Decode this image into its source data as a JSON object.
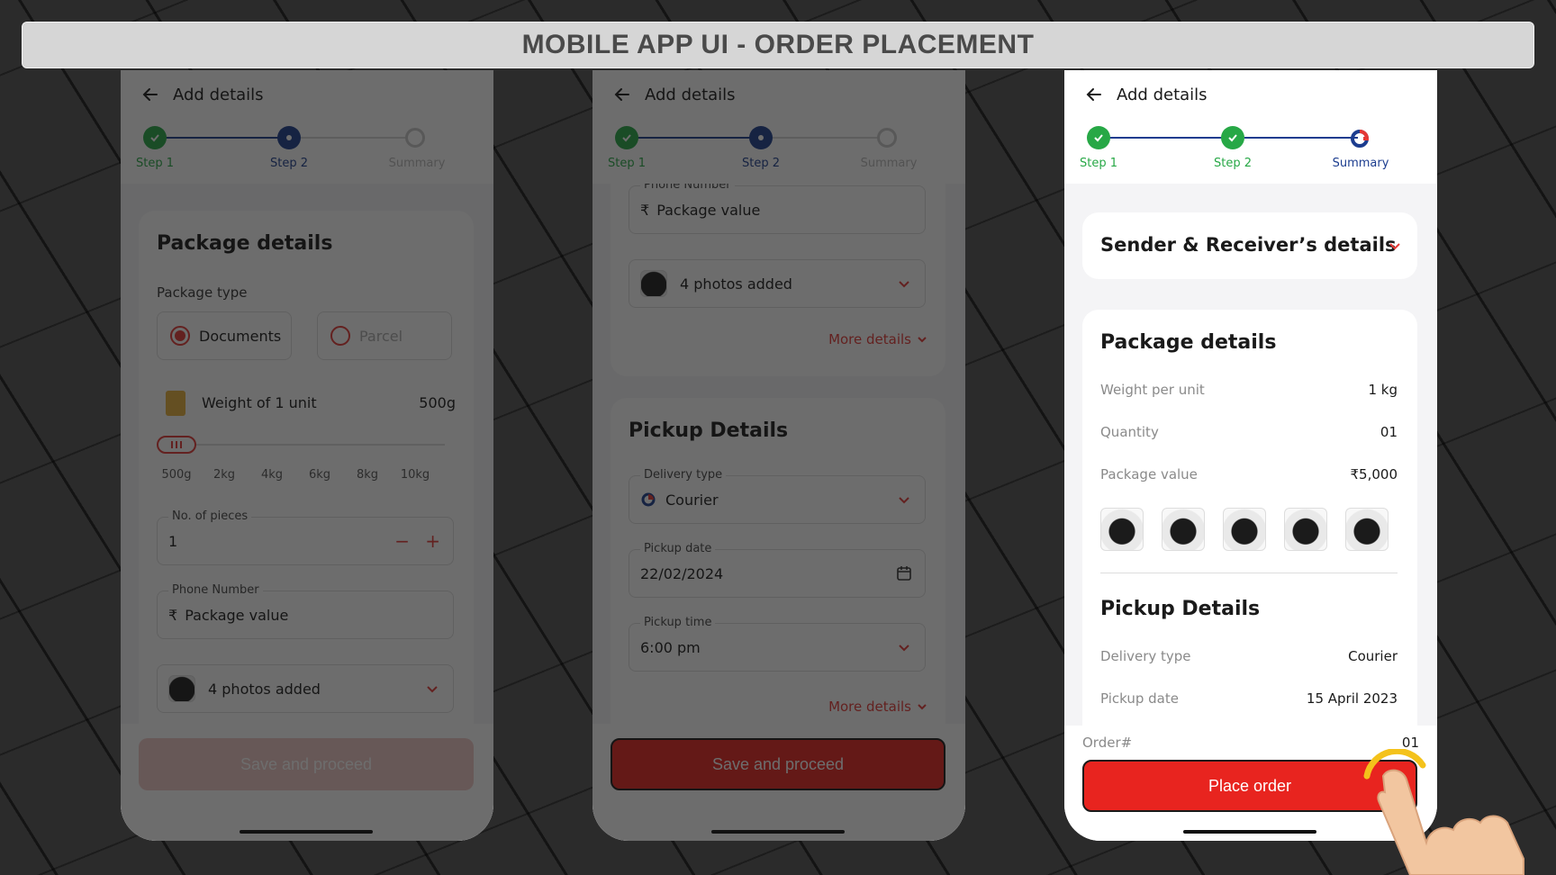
{
  "banner": {
    "title": "MOBILE APP UI - ORDER PLACEMENT"
  },
  "header": {
    "title": "Add details"
  },
  "steps": [
    {
      "label": "Step 1"
    },
    {
      "label": "Step 2"
    },
    {
      "label": "Summary"
    }
  ],
  "screen1": {
    "package_title": "Package details",
    "package_type_label": "Package type",
    "options": [
      "Documents",
      "Parcel"
    ],
    "weight_label": "Weight of 1 unit",
    "weight_value": "500g",
    "slider_ticks": [
      "500g",
      "2kg",
      "4kg",
      "6kg",
      "8kg",
      "10kg"
    ],
    "slider_level": 0,
    "pieces_label": "No. of pieces",
    "pieces_value": "1",
    "phone_label": "Phone Number",
    "currency_symbol": "₹",
    "package_value_placeholder": "Package value",
    "photos_text": "4 photos added",
    "button": "Save and proceed"
  },
  "screen2": {
    "phone_label": "Phone Number",
    "currency_symbol": "₹",
    "package_value_placeholder": "Package value",
    "photos_text": "4 photos added",
    "more_details": "More details",
    "pickup_title": "Pickup Details",
    "delivery_type_label": "Delivery type",
    "delivery_type_value": "Courier",
    "pickup_date_label": "Pickup date",
    "pickup_date_value": "22/02/2024",
    "pickup_time_label": "Pickup time",
    "pickup_time_value": "6:00 pm",
    "more_details_2": "More details",
    "button": "Save and proceed"
  },
  "screen3": {
    "sender_title": "Sender & Receiver’s details",
    "package_title": "Package details",
    "rows": [
      {
        "k": "Weight per unit",
        "v": "1 kg"
      },
      {
        "k": "Quantity",
        "v": "01"
      },
      {
        "k": "Package value",
        "v": "₹5,000"
      }
    ],
    "pickup_title": "Pickup Details",
    "pickup_rows": [
      {
        "k": "Delivery type",
        "v": "Courier"
      },
      {
        "k": "Pickup date",
        "v": "15 April 2023"
      }
    ],
    "order_label": "Order#",
    "order_value": "01",
    "button": "Place order"
  },
  "colors": {
    "accent_red": "#e8241f",
    "step_done": "#27a846",
    "step_active": "#1c3d8f"
  }
}
